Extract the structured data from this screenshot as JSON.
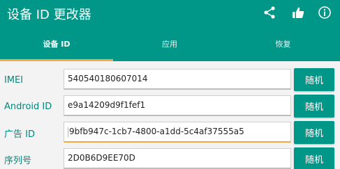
{
  "app": {
    "title": "设备 ID 更改器",
    "actions": [
      {
        "icon": "share-icon"
      },
      {
        "icon": "thumbs-up-icon"
      },
      {
        "icon": "info-icon"
      }
    ]
  },
  "tabs": [
    {
      "label": "设备 ID",
      "active": true
    },
    {
      "label": "应用",
      "active": false
    },
    {
      "label": "恢复",
      "active": false
    }
  ],
  "fields": [
    {
      "label": "IMEI",
      "value": "540540180607014",
      "button": "随机"
    },
    {
      "label": "Android ID",
      "value": "e9a14209d9f1fef1",
      "button": "随机"
    },
    {
      "label": "广告 ID",
      "value": "9bfb947c-1cb7-4800-a1dd-5c4af37555a5",
      "button": "随机",
      "focused": true
    },
    {
      "label": "序列号",
      "value": "2D0B6D9EE70D",
      "button": "随机"
    }
  ],
  "colors": {
    "primary": "#009688",
    "accent": "#f4a742",
    "label": "#00897b"
  }
}
